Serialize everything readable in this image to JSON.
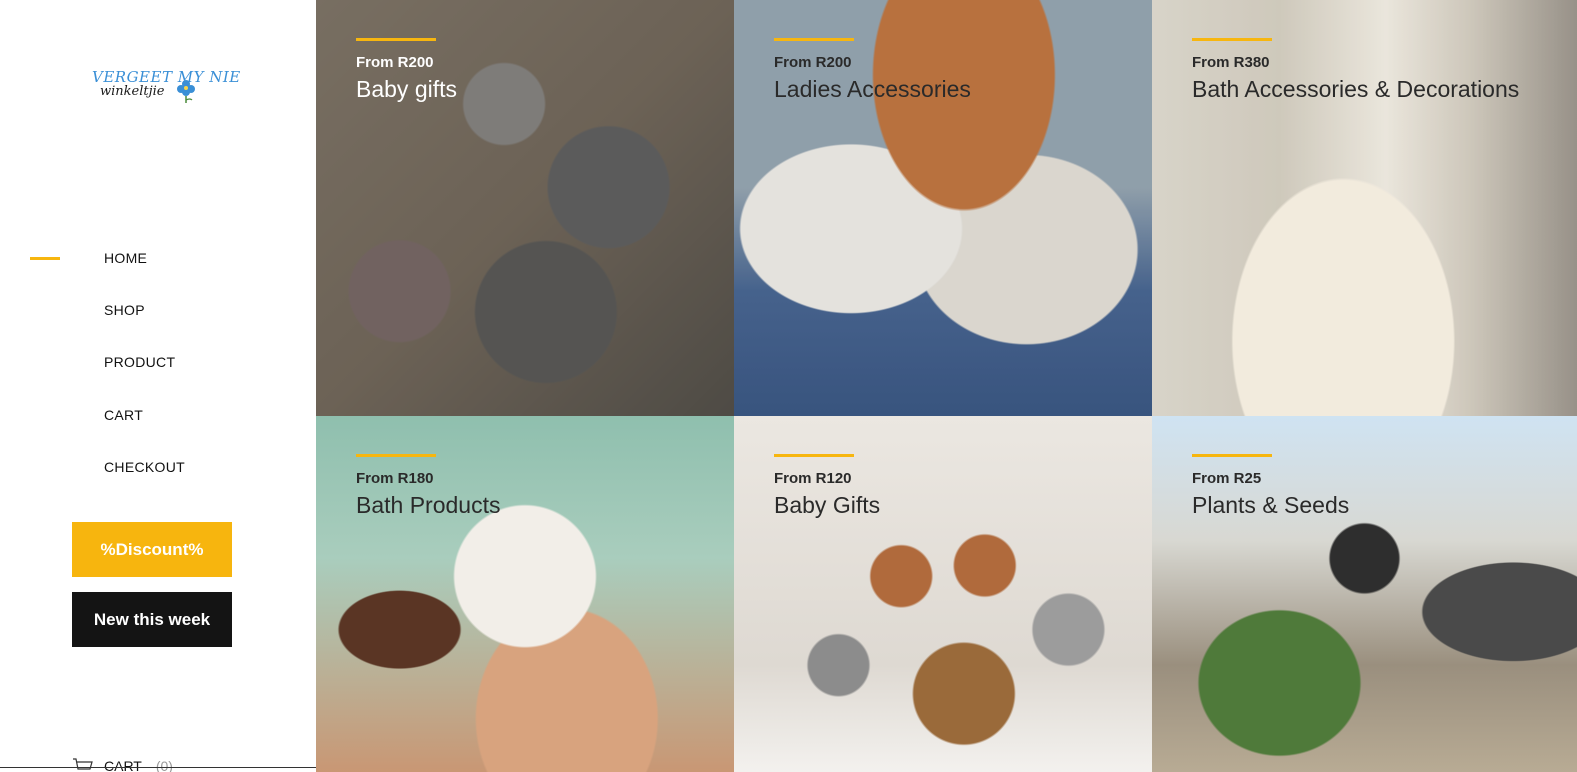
{
  "brand": {
    "logo_line1": "VERGEET MY NIE",
    "logo_line2": "winkeltjie",
    "logo_flower_color": "#3a8fd6"
  },
  "nav": {
    "accent_color": "#f7b60f",
    "items": [
      {
        "label": "HOME",
        "active": true
      },
      {
        "label": "SHOP",
        "active": false
      },
      {
        "label": "PRODUCT",
        "active": false
      },
      {
        "label": "CART",
        "active": false
      },
      {
        "label": "CHECKOUT",
        "active": false
      }
    ]
  },
  "buttons": {
    "discount_label": "%Discount%",
    "discount_color": "#f7b50e",
    "new_label": "New this week",
    "new_color": "#141414"
  },
  "cart": {
    "label": "CART",
    "count": "(0)",
    "icon": "cart-icon"
  },
  "categories": [
    {
      "price": "From R200",
      "title": "Baby gifts"
    },
    {
      "price": "From R200",
      "title": "Ladies Accessories"
    },
    {
      "price": "From R380",
      "title": "Bath Accessories & Decorations"
    },
    {
      "price": "From R180",
      "title": "Bath Products"
    },
    {
      "price": "From R120",
      "title": "Baby Gifts"
    },
    {
      "price": "From R25",
      "title": "Plants & Seeds"
    }
  ]
}
